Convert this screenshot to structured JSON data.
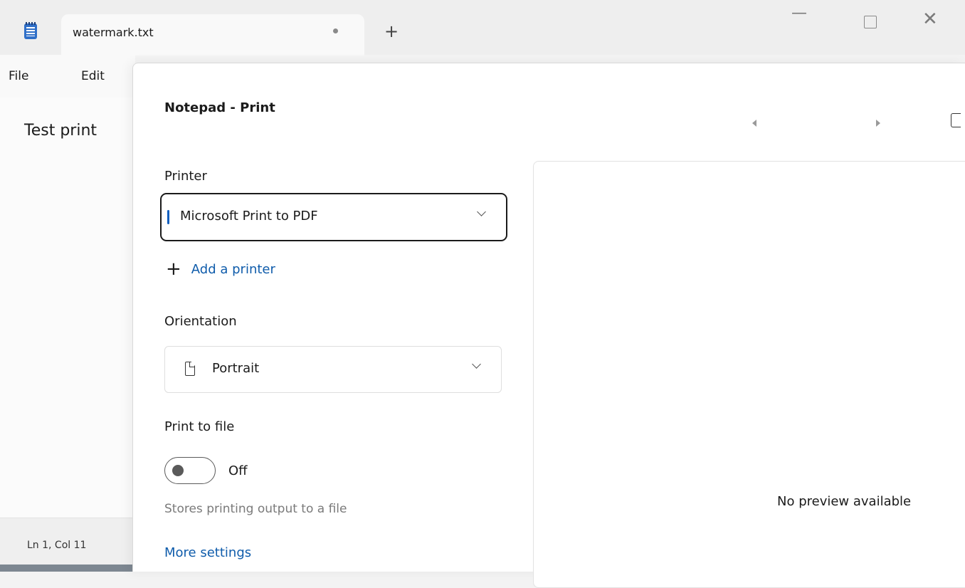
{
  "window": {
    "tab_title": "watermark.txt",
    "new_tab_symbol": "+",
    "minimize_symbol": "—",
    "close_symbol": "✕"
  },
  "menu": {
    "file": "File",
    "edit": "Edit"
  },
  "editor": {
    "content": "Test print"
  },
  "status": {
    "position": "Ln 1, Col 11"
  },
  "print_dialog": {
    "title": "Notepad - Print",
    "printer_label": "Printer",
    "printer_selected": "Microsoft Print to PDF",
    "add_printer": "Add a printer",
    "orientation_label": "Orientation",
    "orientation_selected": "Portrait",
    "print_to_file_label": "Print to file",
    "print_to_file_state": "Off",
    "print_to_file_hint": "Stores printing output to a file",
    "more_settings": "More settings",
    "preview_message": "No preview available"
  },
  "colors": {
    "accent": "#0f5fc0",
    "link": "#0f5cab"
  },
  "icons": {
    "app": "notepad-icon",
    "add": "plus-icon",
    "orientation": "page-portrait-icon",
    "nav_prev": "triangle-left-icon",
    "nav_next": "triangle-right-icon"
  }
}
